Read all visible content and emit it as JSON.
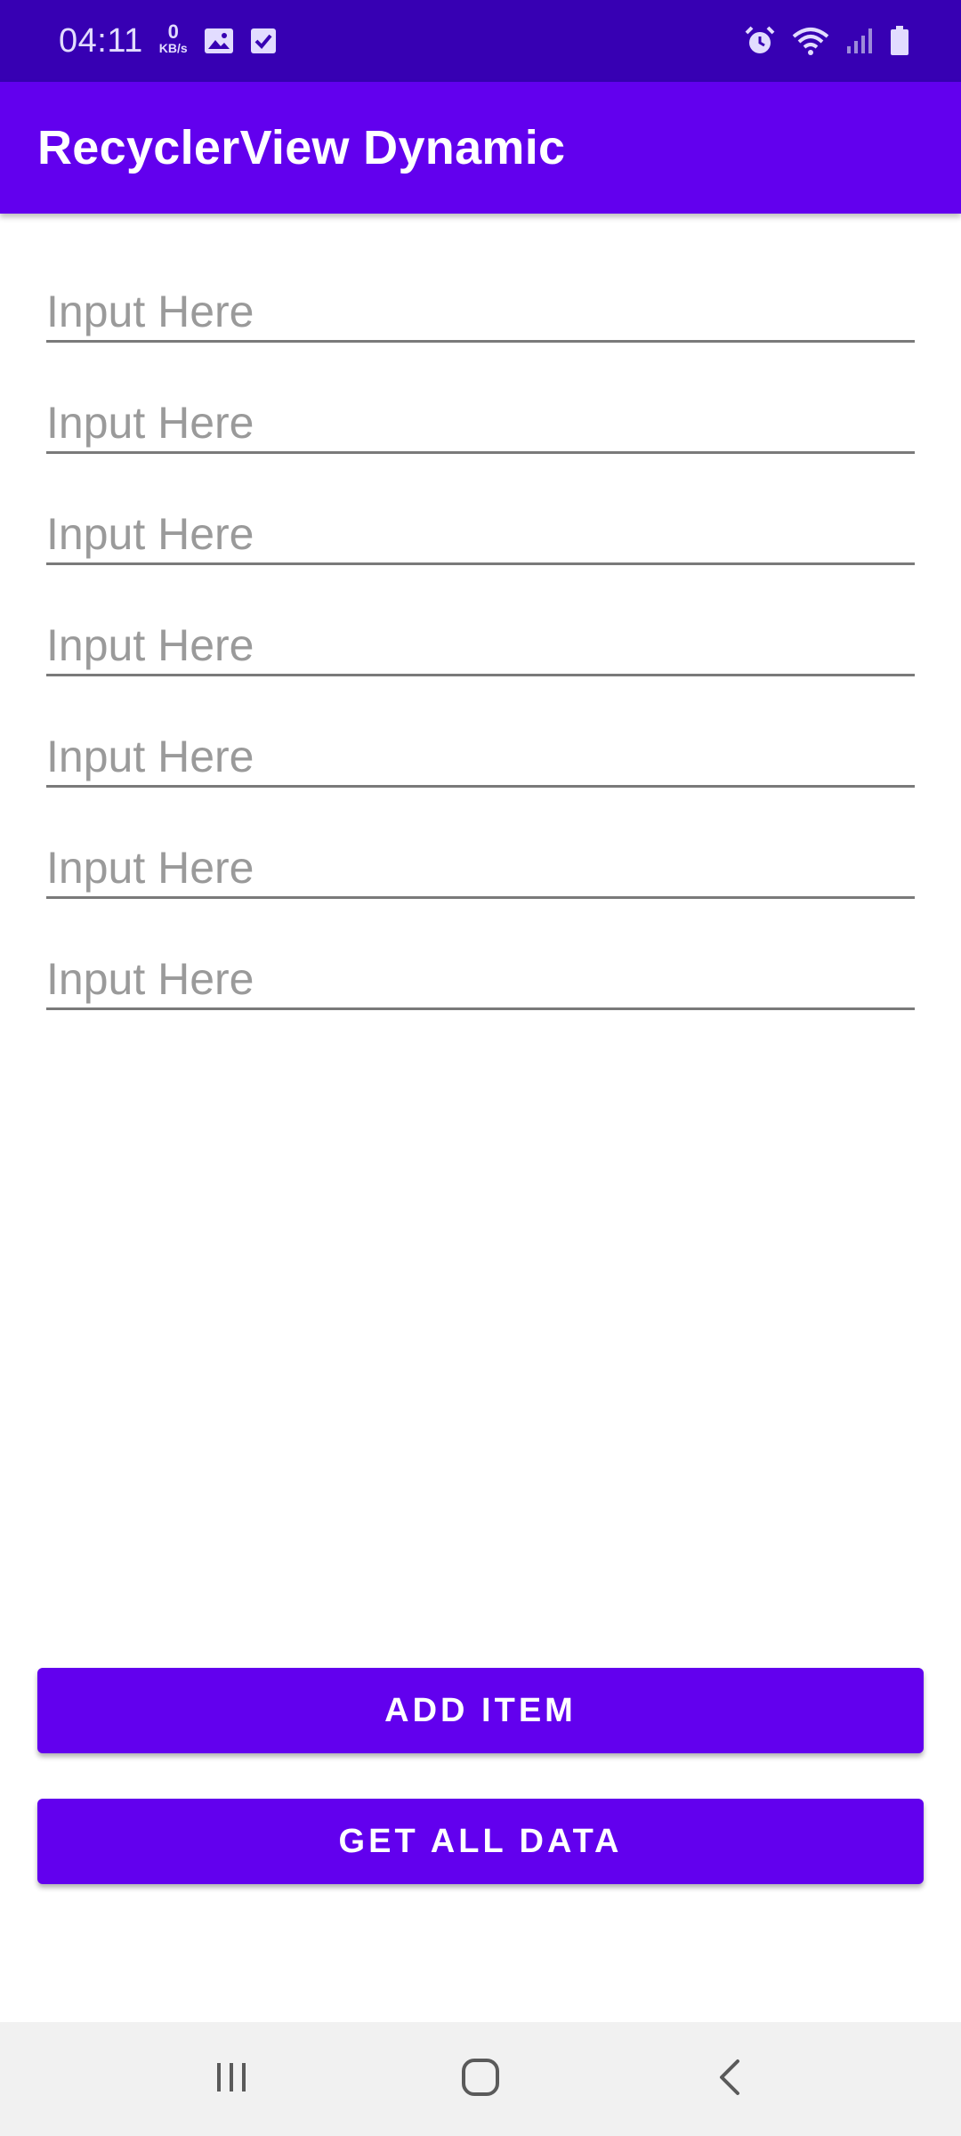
{
  "status_bar": {
    "time": "04:11",
    "net_speed_value": "0",
    "net_speed_unit": "KB/s",
    "left_icons": [
      "image-icon",
      "checkbox-icon"
    ],
    "right_icons": [
      "alarm-icon",
      "wifi-icon",
      "signal-icon",
      "battery-icon"
    ]
  },
  "app_bar": {
    "title": "RecyclerView Dynamic",
    "color": "#6200ee"
  },
  "list": {
    "items": [
      {
        "value": "",
        "placeholder": "Input Here"
      },
      {
        "value": "",
        "placeholder": "Input Here"
      },
      {
        "value": "",
        "placeholder": "Input Here"
      },
      {
        "value": "",
        "placeholder": "Input Here"
      },
      {
        "value": "",
        "placeholder": "Input Here"
      },
      {
        "value": "",
        "placeholder": "Input Here"
      },
      {
        "value": "",
        "placeholder": "Input Here"
      }
    ]
  },
  "actions": {
    "add_label": "ADD ITEM",
    "get_label": "GET ALL DATA"
  },
  "nav_bar": {
    "icons": [
      "recent-apps-icon",
      "home-icon",
      "back-icon"
    ]
  },
  "colors": {
    "status_bar": "#3700b3",
    "primary": "#6200ee"
  }
}
